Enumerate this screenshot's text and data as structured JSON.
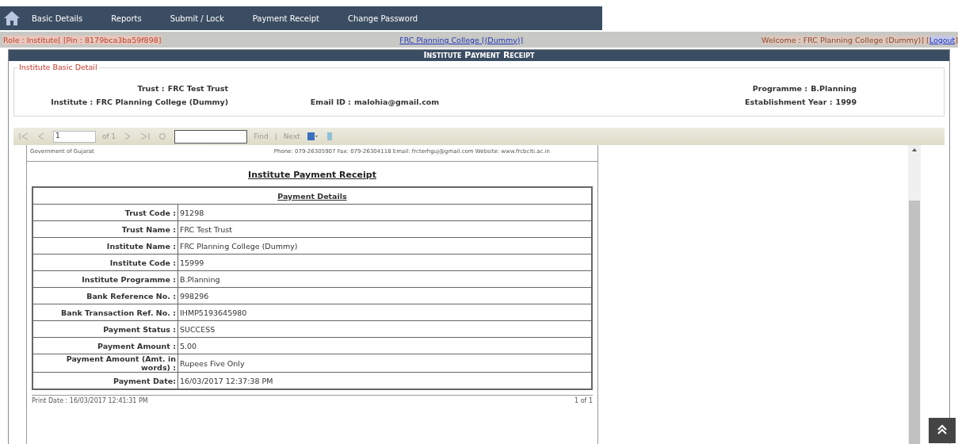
{
  "nav": {
    "items": [
      {
        "label": "Basic Details"
      },
      {
        "label": "Reports"
      },
      {
        "label": "Submit / Lock"
      },
      {
        "label": "Payment Receipt"
      },
      {
        "label": "Change Password"
      }
    ]
  },
  "info_bar": {
    "role": "Role : Institute[ [Pin : 8179bca3ba59f898]",
    "college": "FRC Planning College [(Dummy)]",
    "welcome": "Welcome : FRC Planning College (Dummy)] [",
    "logout": "Logout",
    "end": "]"
  },
  "panel": {
    "title": "Institute Payment Receipt",
    "basic_detail": {
      "legend": "Institute Basic Detail",
      "fields": [
        {
          "label": "Trust :",
          "value": "FRC Test Trust"
        },
        {
          "label": "Programme :",
          "value": "B.Planning"
        },
        {
          "label": "Institute :",
          "value": "FRC Planning College (Dummy)"
        },
        {
          "label": "Email ID :",
          "value": "malohia@gmail.com"
        },
        {
          "label": "Establishment Year :",
          "value": "1999"
        }
      ]
    },
    "viewer_toolbar": {
      "page": "1",
      "of": "of 1",
      "find": "Find",
      "separator": "|",
      "next": "Next"
    },
    "report": {
      "header_left": "Government of Gujarat",
      "header_right": "Phone: 079-26305907 Fax: 079-26304118 Email: frcterhguj@gmail.com Website: www.frcbciti.ac.in",
      "title": "Institute Payment Receipt",
      "table_title": "Payment Details",
      "rows": [
        {
          "label": "Trust Code :",
          "value": "91298"
        },
        {
          "label": "Trust Name :",
          "value": "FRC Test Trust"
        },
        {
          "label": "Institute Name :",
          "value": "FRC Planning College (Dummy)"
        },
        {
          "label": "Institute Code :",
          "value": "15999"
        },
        {
          "label": "Institute Programme :",
          "value": "B.Planning"
        },
        {
          "label": "Bank Reference No. :",
          "value": "998296"
        },
        {
          "label": "Bank Transaction Ref. No. :",
          "value": "IHMP5193645980"
        },
        {
          "label": "Payment Status :",
          "value": "SUCCESS"
        },
        {
          "label": "Payment Amount :",
          "value": "5.00"
        },
        {
          "label": "Payment Amount (Amt. in words) :",
          "value": "Rupees Five Only"
        },
        {
          "label": "Payment Date:",
          "value": "16/03/2017 12:37:38 PM"
        }
      ],
      "print_date": "Print Date : 16/03/2017 12:41:31 PM",
      "page_count": "1 of 1"
    }
  }
}
